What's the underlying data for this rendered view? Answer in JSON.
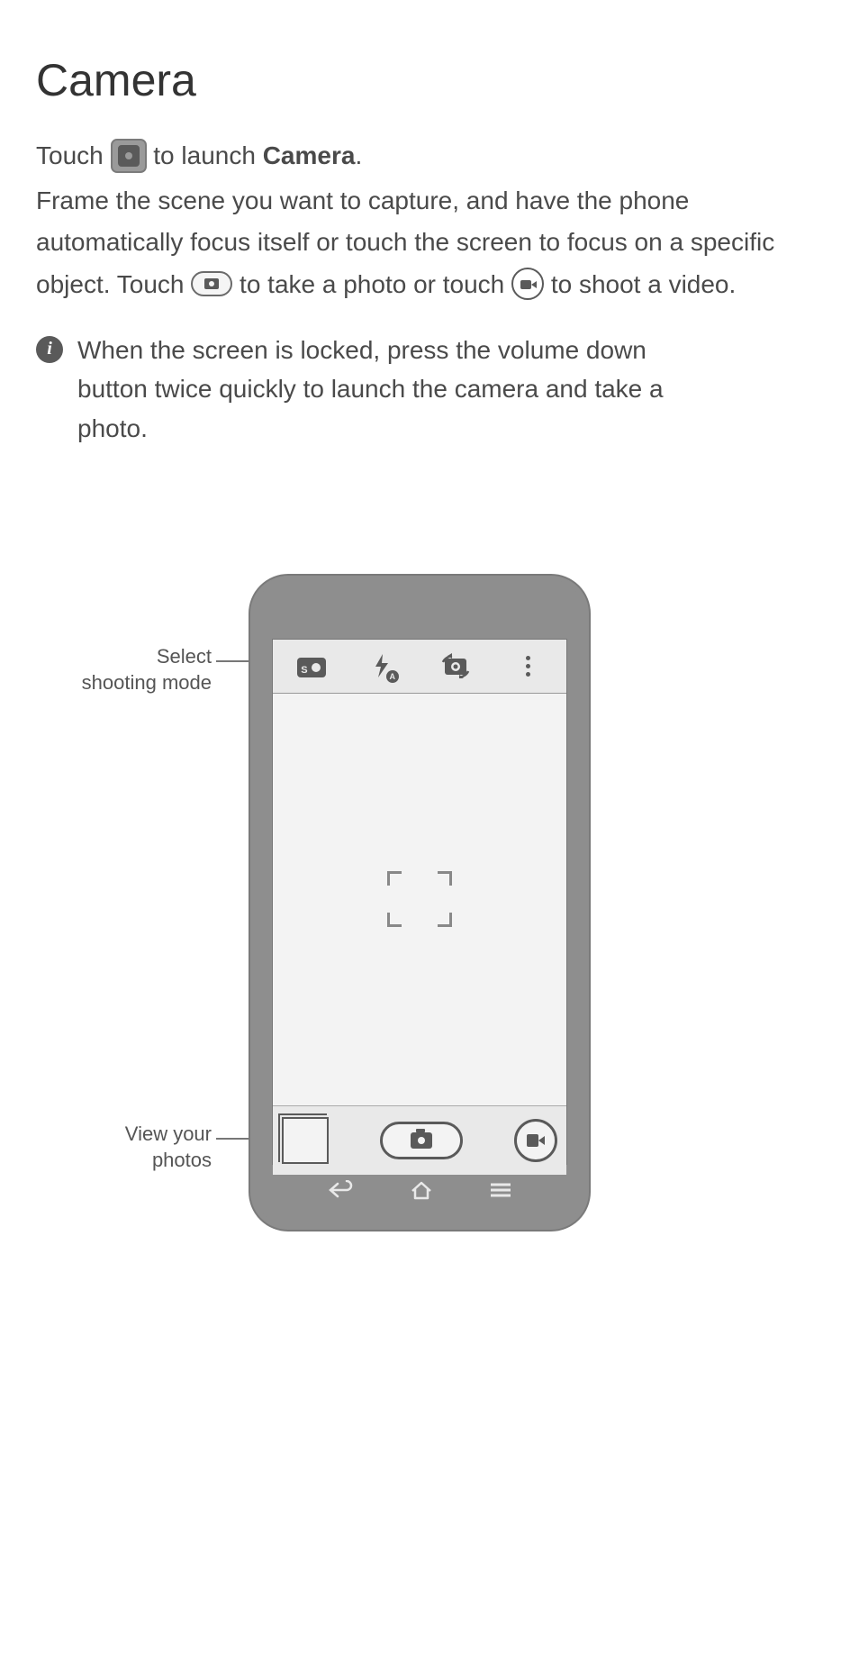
{
  "title": "Camera",
  "intro": {
    "line1_pre": "Touch ",
    "line1_post": " to launch ",
    "line1_bold": "Camera",
    "line1_end": ".",
    "body_a": "Frame the scene you want to capture, and have the phone automatically focus itself or touch the screen to focus on a specific object. Touch ",
    "body_b": " to take a photo or touch ",
    "body_c": " to shoot a video."
  },
  "tip": {
    "glyph": "i",
    "text": "When the screen is locked, press the volume down button twice quickly to launch the camera and take a photo."
  },
  "callouts": {
    "mode_l1": "Select",
    "mode_l2": "shooting mode",
    "gallery_l1": "View your",
    "gallery_l2": "photos"
  },
  "icons": {
    "flash_auto_label": "A",
    "mode_label": "S"
  }
}
